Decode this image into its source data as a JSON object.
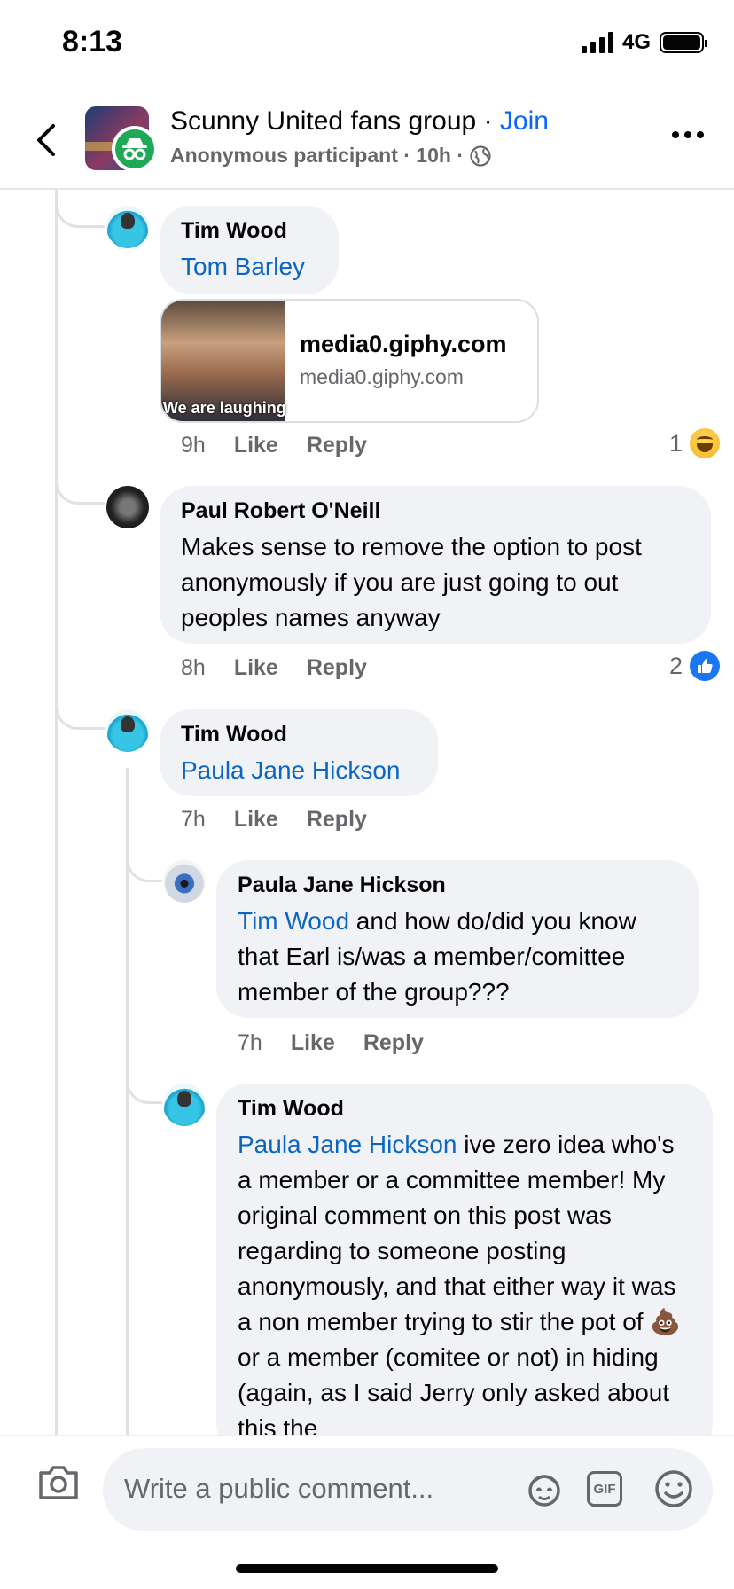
{
  "status_bar": {
    "time": "8:13",
    "network": "4G"
  },
  "header": {
    "title": "Scunny United fans group",
    "separator": " · ",
    "join": "Join",
    "subtitle": "Anonymous participant · 10h ·"
  },
  "comments": [
    {
      "author": "Tim Wood",
      "mention": "Tom Barley",
      "link": {
        "title": "media0.giphy.com",
        "domain": "media0.giphy.com",
        "caption": "We are laughing"
      },
      "time": "9h",
      "like": "Like",
      "reply": "Reply",
      "reactions": {
        "count": "1",
        "type": "haha"
      }
    },
    {
      "author": "Paul Robert O'Neill",
      "text": "Makes sense to remove the option to post anonymously if you are just going to out peoples names anyway",
      "time": "8h",
      "like": "Like",
      "reply": "Reply",
      "reactions": {
        "count": "2",
        "type": "like"
      }
    },
    {
      "author": "Tim Wood",
      "mention": "Paula Jane Hickson",
      "time": "7h",
      "like": "Like",
      "reply": "Reply"
    },
    {
      "author": "Paula Jane Hickson",
      "mention": "Tim Wood",
      "text": " and how do/did you know that Earl is/was a member/comittee member of the group???",
      "time": "7h",
      "like": "Like",
      "reply": "Reply"
    },
    {
      "author": "Tim Wood",
      "mention": "Paula Jane Hickson",
      "text_before_emoji": " ive zero idea who's a member or a committee member! My original comment on this post was regarding to someone posting anonymously, and that either way it was a non member trying to stir the pot of ",
      "emoji": "💩",
      "text_after_emoji": "  or  a member (comitee or not) in hiding (again, as I said Jerry only asked about this the"
    }
  ],
  "composer": {
    "placeholder": "Write a public comment...",
    "gif_label": "GIF"
  }
}
